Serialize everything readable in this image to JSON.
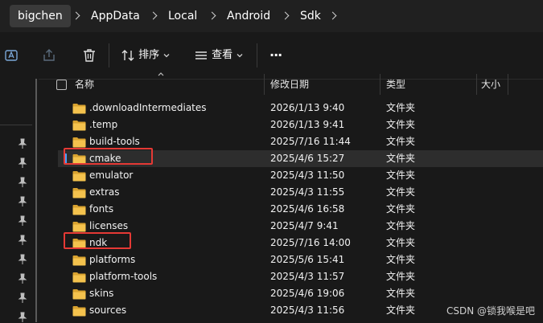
{
  "breadcrumb": [
    "bigchen",
    "AppData",
    "Local",
    "Android",
    "Sdk"
  ],
  "toolbar": {
    "sort_label": "排序",
    "view_label": "查看",
    "more_label": "···"
  },
  "columns": {
    "name": "名称",
    "modified": "修改日期",
    "type": "类型",
    "size": "大小"
  },
  "rows": [
    {
      "name": ".downloadIntermediates",
      "modified": "2026/1/13 9:40",
      "type": "文件夹"
    },
    {
      "name": ".temp",
      "modified": "2026/1/13 9:41",
      "type": "文件夹"
    },
    {
      "name": "build-tools",
      "modified": "2025/7/16 11:44",
      "type": "文件夹"
    },
    {
      "name": "cmake",
      "modified": "2025/4/6 15:27",
      "type": "文件夹",
      "selected": true,
      "highlighted": true
    },
    {
      "name": "emulator",
      "modified": "2025/4/3 11:50",
      "type": "文件夹"
    },
    {
      "name": "extras",
      "modified": "2025/4/3 11:55",
      "type": "文件夹"
    },
    {
      "name": "fonts",
      "modified": "2025/4/6 16:58",
      "type": "文件夹"
    },
    {
      "name": "licenses",
      "modified": "2025/4/7 9:41",
      "type": "文件夹"
    },
    {
      "name": "ndk",
      "modified": "2025/7/16 14:00",
      "type": "文件夹",
      "highlighted": true
    },
    {
      "name": "platforms",
      "modified": "2025/5/6 15:41",
      "type": "文件夹"
    },
    {
      "name": "platform-tools",
      "modified": "2025/4/3 11:57",
      "type": "文件夹"
    },
    {
      "name": "skins",
      "modified": "2025/4/6 19:06",
      "type": "文件夹"
    },
    {
      "name": "sources",
      "modified": "2025/4/3 11:56",
      "type": "文件夹"
    }
  ],
  "colors": {
    "folder": "#f4c24d",
    "highlight": "#e53935",
    "selection_accent": "#4aa3ff"
  },
  "watermark": "CSDN @锁我喉是吧"
}
